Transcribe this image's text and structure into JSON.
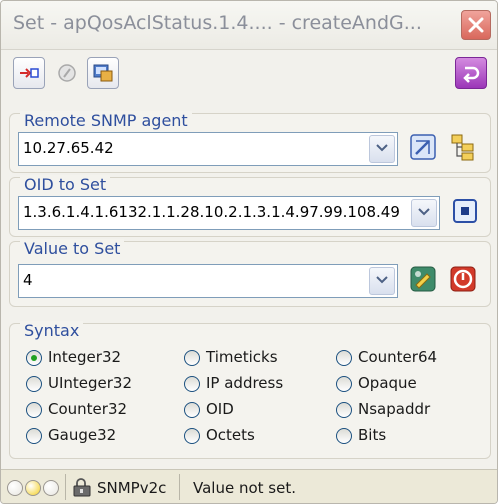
{
  "window": {
    "title": "Set - apQosAclStatus.1.4.... - createAndG...",
    "close_icon": "close-icon"
  },
  "toolbar": {
    "buttons": [
      {
        "icon": "send-request-icon"
      },
      {
        "icon": "stop-icon"
      },
      {
        "icon": "mib-browser-icon"
      },
      {
        "icon": "exit-icon"
      }
    ]
  },
  "remote_agent": {
    "label": "Remote SNMP agent",
    "value": "10.27.65.42",
    "buttons": [
      {
        "icon": "agent-properties-icon"
      },
      {
        "icon": "agent-list-icon"
      }
    ]
  },
  "oid": {
    "label": "OID to Set",
    "value": "1.3.6.1.4.1.6132.1.1.28.10.2.1.3.1.4.97.99.108.49",
    "button_icon": "select-oid-icon"
  },
  "value": {
    "label": "Value to Set",
    "value": "4",
    "buttons": [
      {
        "icon": "value-editor-icon"
      },
      {
        "icon": "set-value-icon"
      }
    ]
  },
  "syntax": {
    "label": "Syntax",
    "selected": "Integer32",
    "options": [
      "Integer32",
      "UInteger32",
      "Counter32",
      "Gauge32",
      "Timeticks",
      "IP address",
      "OID",
      "Octets",
      "Counter64",
      "Opaque",
      "Nsapaddr",
      "Bits"
    ]
  },
  "status": {
    "leds": [
      "#e8e6e0",
      "#f4d023",
      "#e8e6e0"
    ],
    "version": "SNMPv2c",
    "message": "Value not set."
  },
  "colors": {
    "group_label": "#2f4f9e",
    "radio_selected": "#21a121",
    "led_active": "#f4d023"
  }
}
